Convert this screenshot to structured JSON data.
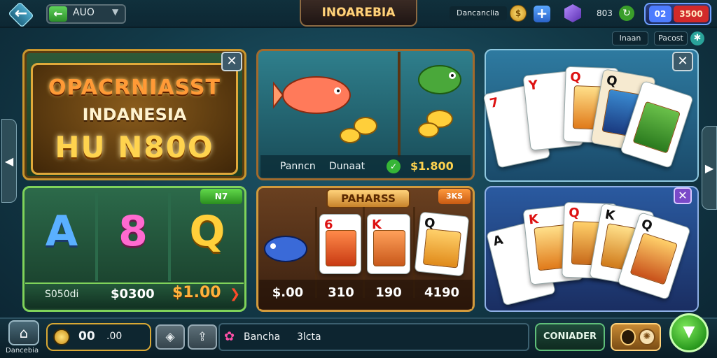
{
  "topbar": {
    "back_icon": "arrow-left-icon",
    "balance_label": "AUO",
    "title": "INOAREBIA",
    "username": "Dancanclia",
    "gem_count": "803",
    "score_left": "02",
    "score_right": "3500"
  },
  "subbuttons": {
    "left": "Inaan",
    "right": "Pacost"
  },
  "cards": {
    "promo": {
      "line1": "OPACRNIASST",
      "line2": "INDANESIA",
      "line3": "HU N80O"
    },
    "fish": {
      "label1": "Panncn",
      "label2": "Dunaat",
      "price": "$1.800"
    },
    "slots": {
      "badge": "N7",
      "symbols": [
        "A",
        "8",
        "Q"
      ],
      "label": "S050di",
      "amount": "$0300",
      "price": "$1.00"
    },
    "pahars": {
      "title": "PAHARSS",
      "badge": "3KS",
      "prices": [
        "$.00",
        "310",
        "190",
        "4190"
      ]
    }
  },
  "bottombar": {
    "home_label": "Dancebia",
    "coins_main": "00",
    "coins_secondary": ".00",
    "chat_name": "Bancha",
    "chat_message": "3lcta",
    "confirm_label": "CONIADER"
  },
  "colors": {
    "accent_gold": "#ffd34e",
    "accent_green": "#36b536",
    "frame_orange": "#d19a3c"
  }
}
